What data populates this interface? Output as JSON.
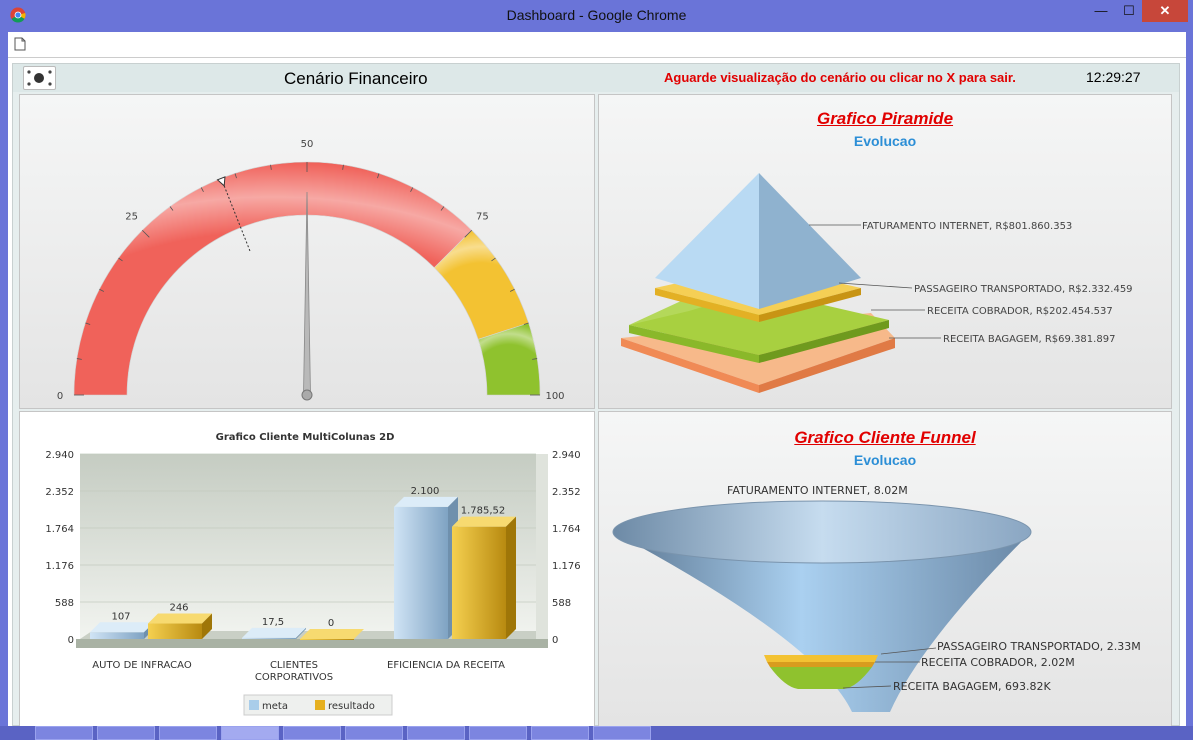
{
  "window": {
    "title": "Dashboard - Google Chrome",
    "minimize": "—",
    "maximize": "☐",
    "close": "✕"
  },
  "dashboard": {
    "title": "Cenário Financeiro",
    "warning": "Aguarde visualização do cenário ou clicar no X para sair.",
    "clock": "12:29:27"
  },
  "gauge": {
    "min": 0,
    "max": 100,
    "value": 50,
    "marker": 38,
    "tick_labels": [
      "0",
      "25",
      "50",
      "75",
      "100"
    ],
    "bands": [
      {
        "from": 0,
        "to": 75,
        "color": "#f0625a"
      },
      {
        "from": 75,
        "to": 90,
        "color": "#f3c232"
      },
      {
        "from": 90,
        "to": 100,
        "color": "#8fc22e"
      }
    ]
  },
  "pyramid": {
    "title": "Grafico Piramide",
    "subtitle": "Evolucao",
    "items": [
      {
        "label": "FATURAMENTO INTERNET, R$801.860.353",
        "color": "#a9cdea"
      },
      {
        "label": "PASSAGEIRO TRANSPORTADO, R$2.332.459",
        "color": "#f3c232"
      },
      {
        "label": "RECEITA COBRADOR, R$202.454.537",
        "color": "#93c22e"
      },
      {
        "label": "RECEITA BAGAGEM, R$69.381.897",
        "color": "#f59a62"
      }
    ]
  },
  "chart_data": {
    "type": "bar",
    "title": "Grafico Cliente MultiColunas 2D",
    "categories": [
      "AUTO DE INFRACAO",
      "CLIENTES CORPORATIVOS",
      "EFICIENCIA DA RECEITA"
    ],
    "category_lines": [
      [
        "AUTO DE INFRACAO"
      ],
      [
        "CLIENTES",
        "CORPORATIVOS"
      ],
      [
        "EFICIENCIA DA RECEITA"
      ]
    ],
    "series": [
      {
        "name": "meta",
        "values": [
          107,
          17.5,
          2100
        ],
        "labels": [
          "107",
          "17,5",
          "2.100"
        ],
        "color": "#a9cdea"
      },
      {
        "name": "resultado",
        "values": [
          246,
          0,
          1785.52
        ],
        "labels": [
          "246",
          "0",
          "1.785,52"
        ],
        "color": "#e6b020"
      }
    ],
    "y_ticks": [
      0,
      588,
      1176,
      1764,
      2352,
      2940
    ],
    "y_tick_labels": [
      "0",
      "588",
      "1.176",
      "1.764",
      "2.352",
      "2.940"
    ],
    "ylim": [
      0,
      2940
    ],
    "legend_position": "bottom"
  },
  "funnel": {
    "title": "Grafico Cliente Funnel",
    "subtitle": "Evolucao",
    "items": [
      {
        "label": "FATURAMENTO INTERNET, 8.02M",
        "value": 8.02,
        "color": "#9ec3e4"
      },
      {
        "label": "PASSAGEIRO TRANSPORTADO, 2.33M",
        "value": 2.33,
        "color": "#f3c232"
      },
      {
        "label": "RECEITA COBRADOR, 2.02M",
        "value": 2.02,
        "color": "#e6a020"
      },
      {
        "label": "RECEITA BAGAGEM, 693.82K",
        "value": 0.69382,
        "color": "#8fc22e"
      }
    ]
  }
}
